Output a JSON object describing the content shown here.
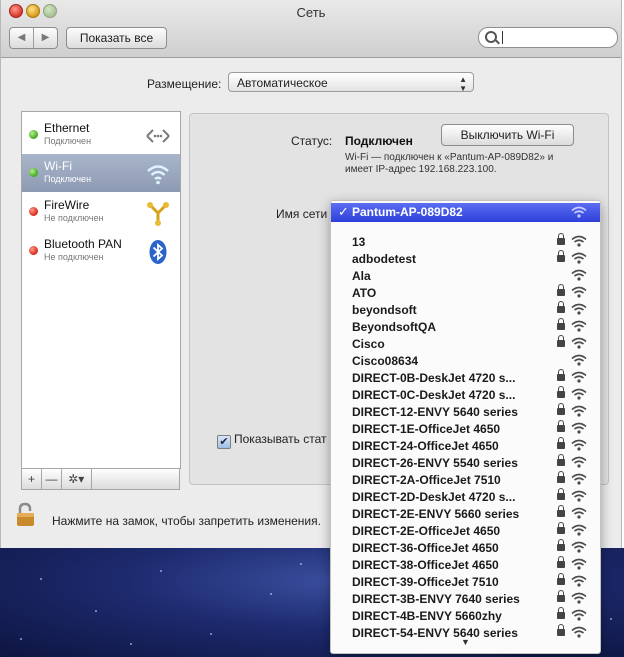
{
  "window": {
    "title": "Сеть"
  },
  "toolbar": {
    "back": "◀",
    "forward": "▶",
    "show_all": "Показать все",
    "search_placeholder": ""
  },
  "location": {
    "label": "Размещение:",
    "value": "Автоматическое"
  },
  "services": [
    {
      "name": "Ethernet",
      "status": "Подключен",
      "dot": "green",
      "icon": "ethernet-icon"
    },
    {
      "name": "Wi-Fi",
      "status": "Подключен",
      "dot": "green",
      "icon": "wifi-icon",
      "selected": true
    },
    {
      "name": "FireWire",
      "status": "Не подключен",
      "dot": "red",
      "icon": "firewire-icon"
    },
    {
      "name": "Bluetooth PAN",
      "status": "Не подключен",
      "dot": "red",
      "icon": "bluetooth-icon"
    }
  ],
  "sidebar_buttons": {
    "add": "+",
    "remove": "—",
    "gear": "✲▾"
  },
  "detail": {
    "status_label": "Статус:",
    "status_value": "Подключен",
    "wifi_off_button": "Выключить Wi-Fi",
    "description": "Wi-Fi — подключен к «Pantum-AP-089D82» и имеет IP-адрес 192.168.223.100.",
    "network_name_label": "Имя сети",
    "show_status_label": "Показывать стат",
    "show_status_checked": true
  },
  "lock": {
    "text": "Нажмите на замок, чтобы запретить изменения."
  },
  "network_menu": {
    "current": "Pantum-AP-089D82",
    "networks": [
      {
        "name": "13",
        "locked": true
      },
      {
        "name": "adbodetest",
        "locked": true
      },
      {
        "name": "Ala",
        "locked": false
      },
      {
        "name": "ATO",
        "locked": true
      },
      {
        "name": "beyondsoft",
        "locked": true
      },
      {
        "name": "BeyondsoftQA",
        "locked": true
      },
      {
        "name": "Cisco",
        "locked": true
      },
      {
        "name": "Cisco08634",
        "locked": false
      },
      {
        "name": "DIRECT-0B-DeskJet 4720 s...",
        "locked": true
      },
      {
        "name": "DIRECT-0C-DeskJet 4720 s...",
        "locked": true
      },
      {
        "name": "DIRECT-12-ENVY 5640 series",
        "locked": true
      },
      {
        "name": "DIRECT-1E-OfficeJet 4650",
        "locked": true
      },
      {
        "name": "DIRECT-24-OfficeJet 4650",
        "locked": true
      },
      {
        "name": "DIRECT-26-ENVY 5540 series",
        "locked": true
      },
      {
        "name": "DIRECT-2A-OfficeJet 7510",
        "locked": true
      },
      {
        "name": "DIRECT-2D-DeskJet 4720 s...",
        "locked": true
      },
      {
        "name": "DIRECT-2E-ENVY 5660 series",
        "locked": true
      },
      {
        "name": "DIRECT-2E-OfficeJet 4650",
        "locked": true
      },
      {
        "name": "DIRECT-36-OfficeJet 4650",
        "locked": true
      },
      {
        "name": "DIRECT-38-OfficeJet 4650",
        "locked": true
      },
      {
        "name": "DIRECT-39-OfficeJet 7510",
        "locked": true
      },
      {
        "name": "DIRECT-3B-ENVY 7640 series",
        "locked": true
      },
      {
        "name": "DIRECT-4B-ENVY 5660zhy",
        "locked": true
      },
      {
        "name": "DIRECT-54-ENVY 5640 series",
        "locked": true
      }
    ],
    "scroll_indicator": "▼"
  },
  "colors": {
    "selection": "#2e3fd9",
    "sidebar_selection": "#8d9ab3",
    "connected": "#3ea81d",
    "disconnected": "#d42819"
  }
}
